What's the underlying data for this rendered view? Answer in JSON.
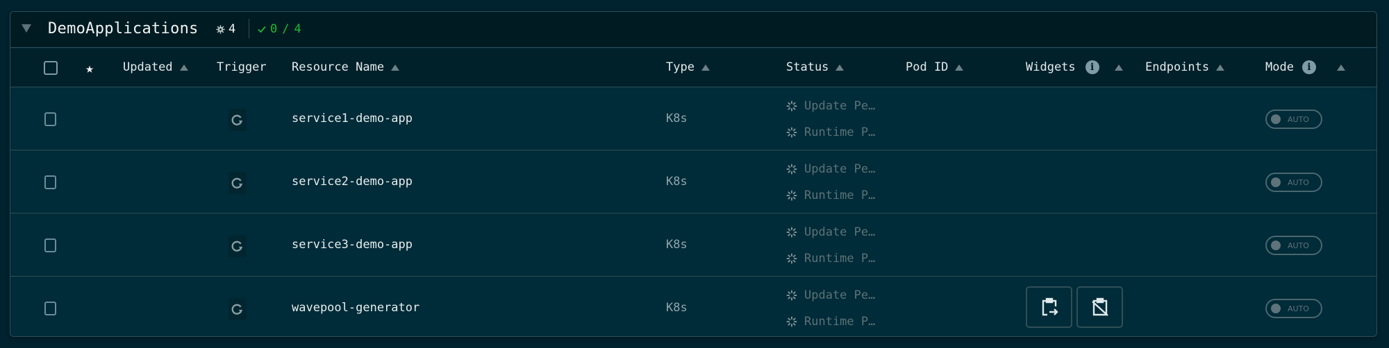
{
  "group": {
    "title": "DemoApplications",
    "resource_count": "4",
    "ready_count": "0",
    "ready_total": "4",
    "ready_separator": "/",
    "ok_color": "#20ba31"
  },
  "columns": {
    "updated": "Updated",
    "trigger": "Trigger",
    "resource_name": "Resource Name",
    "type": "Type",
    "status": "Status",
    "pod_id": "Pod ID",
    "widgets": "Widgets",
    "endpoints": "Endpoints",
    "mode": "Mode"
  },
  "icons": {
    "collapse": "caret-down-icon",
    "resources": "gear-icon",
    "ready": "check-icon",
    "star": "star-icon",
    "info": "info-icon",
    "sort": "sort-up-icon",
    "trigger": "refresh-icon",
    "status": "spinner-icon",
    "widget_copy": "clipboard-arrow-icon",
    "widget_clear": "clipboard-off-icon"
  },
  "rows": [
    {
      "name": "service1-demo-app",
      "type": "K8s",
      "status_update": "Update Pe…",
      "status_runtime": "Runtime P…",
      "pod_id": "",
      "endpoints": "",
      "mode": "AUTO",
      "widgets": []
    },
    {
      "name": "service2-demo-app",
      "type": "K8s",
      "status_update": "Update Pe…",
      "status_runtime": "Runtime P…",
      "pod_id": "",
      "endpoints": "",
      "mode": "AUTO",
      "widgets": []
    },
    {
      "name": "service3-demo-app",
      "type": "K8s",
      "status_update": "Update Pe…",
      "status_runtime": "Runtime P…",
      "pod_id": "",
      "endpoints": "",
      "mode": "AUTO",
      "widgets": []
    },
    {
      "name": "wavepool-generator",
      "type": "K8s",
      "status_update": "Update Pe…",
      "status_runtime": "Runtime P…",
      "pod_id": "",
      "endpoints": "",
      "mode": "AUTO",
      "widgets": [
        "clipboard-arrow-icon",
        "clipboard-off-icon"
      ]
    }
  ]
}
